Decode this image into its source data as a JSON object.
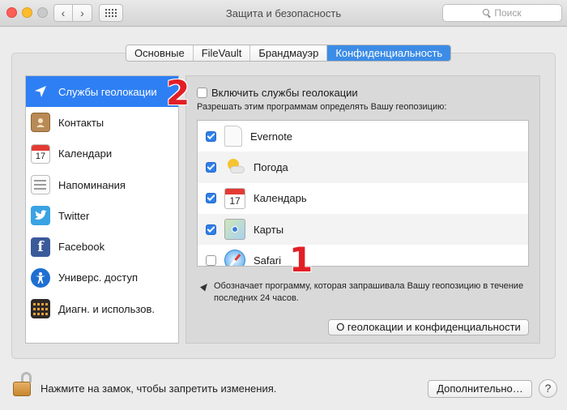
{
  "window": {
    "title": "Защита и безопасность",
    "search_placeholder": "Поиск"
  },
  "tabs": [
    {
      "label": "Основные",
      "active": false
    },
    {
      "label": "FileVault",
      "active": false
    },
    {
      "label": "Брандмауэр",
      "active": false
    },
    {
      "label": "Конфиденциальность",
      "active": true
    }
  ],
  "sidebar": {
    "items": [
      {
        "label": "Службы геолокации",
        "icon": "location-arrow-icon",
        "selected": true
      },
      {
        "label": "Контакты",
        "icon": "contacts-icon"
      },
      {
        "label": "Календари",
        "icon": "calendar-icon",
        "badge": "17"
      },
      {
        "label": "Напоминания",
        "icon": "reminders-icon"
      },
      {
        "label": "Twitter",
        "icon": "twitter-icon"
      },
      {
        "label": "Facebook",
        "icon": "facebook-icon",
        "glyph": "f"
      },
      {
        "label": "Универс. доступ",
        "icon": "accessibility-icon"
      },
      {
        "label": "Диагн. и использов.",
        "icon": "diagnostics-icon"
      }
    ]
  },
  "annotations": {
    "marker_1": "1",
    "marker_2": "2"
  },
  "location": {
    "enable_label": "Включить службы геолокации",
    "enable_checked": false,
    "allow_label": "Разрешать этим программам определять Вашу геопозицию:",
    "apps": [
      {
        "name": "Evernote",
        "checked": true,
        "icon": "evernote-icon"
      },
      {
        "name": "Погода",
        "checked": true,
        "icon": "weather-icon"
      },
      {
        "name": "Календарь",
        "checked": true,
        "icon": "calendar-app-icon",
        "badge": "17"
      },
      {
        "name": "Карты",
        "checked": true,
        "icon": "maps-icon"
      },
      {
        "name": "Safari",
        "checked": false,
        "icon": "safari-icon"
      }
    ],
    "note": "Обозначает программу, которая запрашивала Вашу геопозицию в течение последних 24 часов.",
    "about_button": "О геолокации и конфиденциальности"
  },
  "footer": {
    "lock_text": "Нажмите на замок, чтобы запретить изменения.",
    "advanced_button": "Дополнительно…",
    "help_button": "?"
  },
  "colors": {
    "accent": "#2e7ff3",
    "tab_active": "#3c8ce6",
    "marker": "#e21f26"
  }
}
